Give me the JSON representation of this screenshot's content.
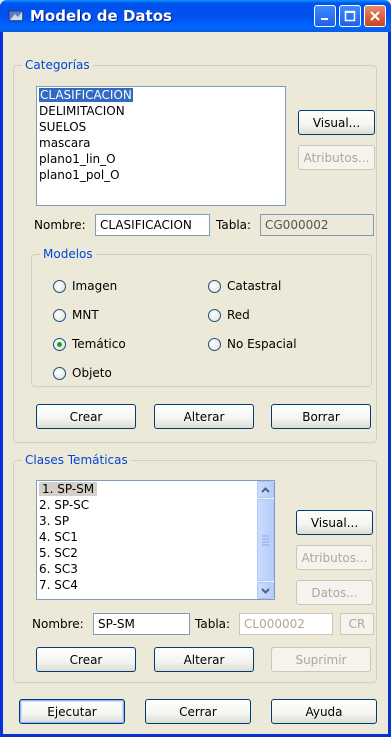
{
  "window": {
    "title": "Modelo de Datos"
  },
  "categorias": {
    "legend": "Categorías",
    "items": [
      "CLASIFICACION",
      "DELIMITACION",
      "SUELOS",
      "mascara",
      "plano1_lin_O",
      "plano1_pol_O"
    ],
    "visual_label": "Visual...",
    "atributos_label": "Atributos...",
    "nombre_label": "Nombre:",
    "nombre_value": "CLASIFICACION",
    "tabla_label": "Tabla:",
    "tabla_value": "CG000002"
  },
  "modelos": {
    "legend": "Modelos",
    "options": [
      "Imagen",
      "Catastral",
      "MNT",
      "Red",
      "Temático",
      "No Espacial",
      "Objeto"
    ],
    "selected": "Temático"
  },
  "categorias_actions": {
    "crear": "Crear",
    "alterar": "Alterar",
    "borrar": "Borrar"
  },
  "clases": {
    "legend": "Clases Temáticas",
    "items": [
      "1. SP-SM",
      "2. SP-SC",
      "3. SP",
      "4. SC1",
      "5. SC2",
      "6. SC3",
      "7. SC4"
    ],
    "visual_label": "Visual...",
    "atributos_label": "Atributos...",
    "datos_label": "Datos...",
    "nombre_label": "Nombre:",
    "nombre_value": "SP-SM",
    "tabla_label": "Tabla:",
    "tabla_value": "CL000002",
    "cr_label": "CR",
    "crear": "Crear",
    "alterar": "Alterar",
    "suprimir": "Suprimir"
  },
  "footer": {
    "ejecutar": "Ejecutar",
    "cerrar": "Cerrar",
    "ayuda": "Ayuda"
  },
  "colors": {
    "titlebar": "#0053ee",
    "legend_text": "#0046d5",
    "selection": "#316ac5",
    "radio_dot": "#21a121"
  }
}
